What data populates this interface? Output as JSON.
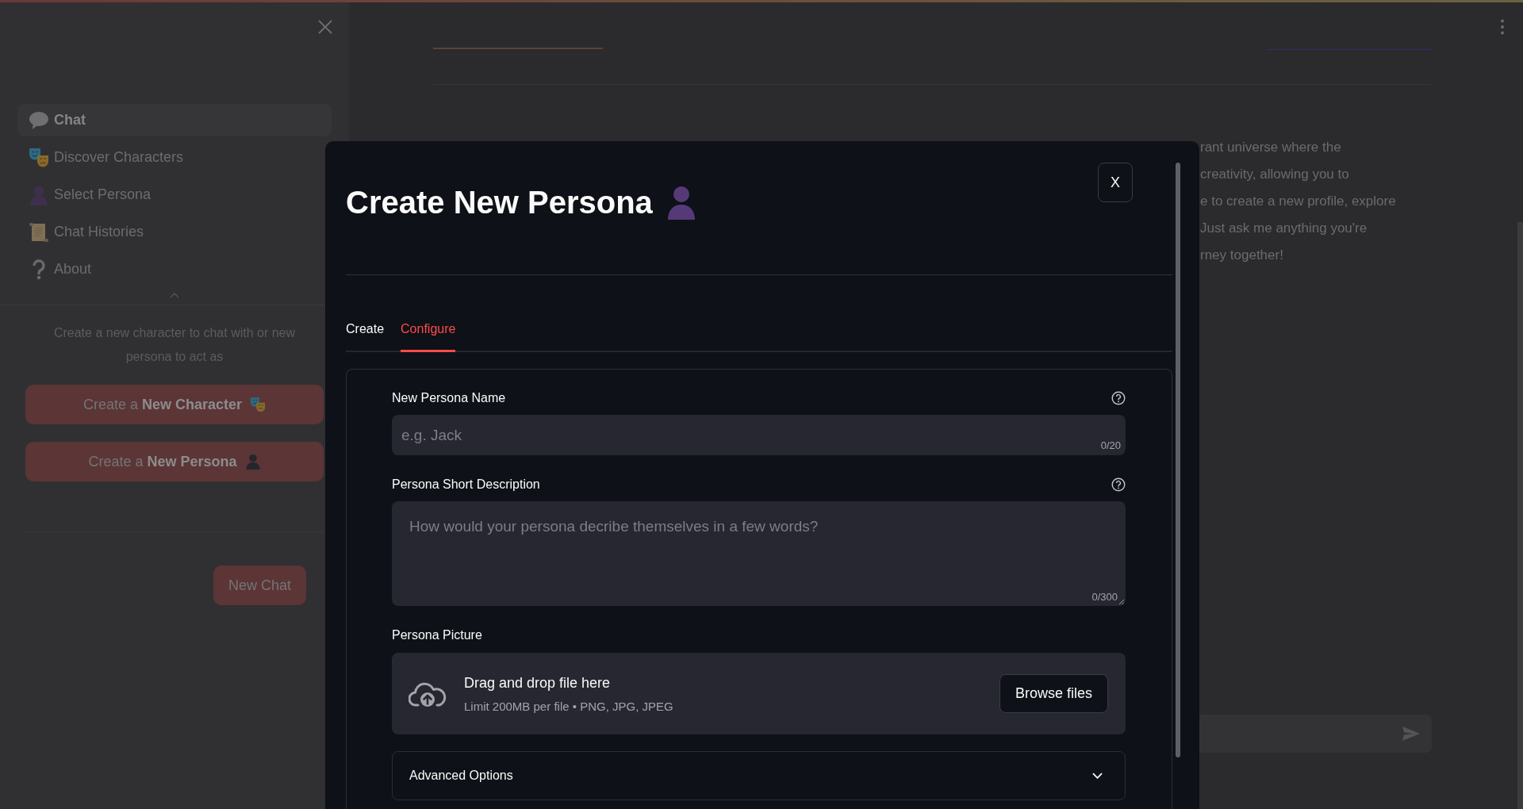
{
  "sidebar": {
    "nav_items": [
      {
        "label": "Chat",
        "selected": true
      },
      {
        "label": "Discover Characters",
        "selected": false
      },
      {
        "label": "Select Persona",
        "selected": false
      },
      {
        "label": "Chat Histories",
        "selected": false
      },
      {
        "label": "About",
        "selected": false
      }
    ],
    "hint": "Create a new character to chat with or new persona to act as",
    "create_buttons": [
      "Create a **New Character**",
      "Create a **New Persona**"
    ],
    "new_chat_button": "New Chat"
  },
  "chat": {
    "message_lines": [
      "rant universe where the",
      "creativity, allowing you to",
      "e to create a new profile, explore",
      "Just ask me anything you're",
      "rney together!"
    ]
  },
  "modal": {
    "title": "Create New Persona",
    "close_button": "X",
    "tabs": [
      {
        "label": "Create",
        "selected": false
      },
      {
        "label": "Configure",
        "selected": true
      }
    ],
    "fields": [
      {
        "kind": "text",
        "label": "New Persona Name",
        "placeholder": "e.g. Jack",
        "counter": "0/20",
        "help": true
      },
      {
        "kind": "textarea",
        "label": "Persona Short Description",
        "placeholder": "How would your persona decribe themselves in a few words?",
        "counter": "0/300",
        "help": true
      },
      {
        "kind": "file",
        "label": "Persona Picture",
        "drop_text": "Drag and drop file here",
        "limit_text": "Limit 200MB per file • PNG, JPG, JPEG",
        "button": "Browse files"
      }
    ],
    "expander": {
      "label": "Advanced Options",
      "expanded": false
    }
  }
}
